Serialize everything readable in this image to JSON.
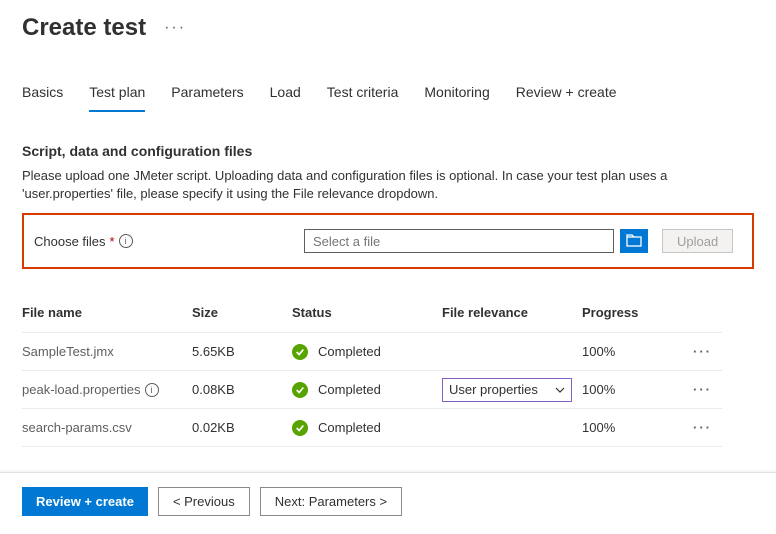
{
  "page": {
    "title": "Create test"
  },
  "tabs": [
    {
      "label": "Basics"
    },
    {
      "label": "Test plan"
    },
    {
      "label": "Parameters"
    },
    {
      "label": "Load"
    },
    {
      "label": "Test criteria"
    },
    {
      "label": "Monitoring"
    },
    {
      "label": "Review + create"
    }
  ],
  "section": {
    "title": "Script, data and configuration files",
    "desc": "Please upload one JMeter script. Uploading data and configuration files is optional. In case your test plan uses a 'user.properties' file, please specify it using the File relevance dropdown."
  },
  "choose": {
    "label": "Choose files",
    "placeholder": "Select a file",
    "upload_label": "Upload"
  },
  "columns": {
    "file_name": "File name",
    "size": "Size",
    "status": "Status",
    "relevance": "File relevance",
    "progress": "Progress"
  },
  "rows": [
    {
      "name": "SampleTest.jmx",
      "size": "5.65KB",
      "status": "Completed",
      "relevance": "",
      "progress": "100%",
      "info": false
    },
    {
      "name": "peak-load.properties",
      "size": "0.08KB",
      "status": "Completed",
      "relevance": "User properties",
      "progress": "100%",
      "info": true
    },
    {
      "name": "search-params.csv",
      "size": "0.02KB",
      "status": "Completed",
      "relevance": "",
      "progress": "100%",
      "info": false
    }
  ],
  "footer": {
    "review": "Review + create",
    "previous": "< Previous",
    "next": "Next: Parameters >"
  }
}
